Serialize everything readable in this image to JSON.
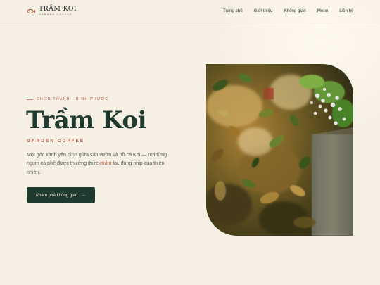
{
  "brand": {
    "name": "TRẦM KOI",
    "tagline": "GARDEN COFFEE",
    "logo_icon": "koi-fish-icon"
  },
  "nav": {
    "items": [
      "Trang chủ",
      "Giới thiệu",
      "Không gian",
      "Menu",
      "Liên hệ"
    ]
  },
  "hero": {
    "eyebrow": "CHƠN THÀNH · BÌNH PHƯỚC",
    "title": "Trầm Koi",
    "subtitle": "GARDEN COFFEE",
    "description_before": "Một góc xanh yên bình giữa sân vườn và hồ cá Koi — nơi từng ngụm cà phê được thưởng thức ",
    "description_highlight": "chậm",
    "description_after": " lại, đúng nhịp của thiên nhiên.",
    "cta_label": "Khám phá không gian",
    "cta_icon": "arrow-right-icon",
    "image_icon": "garden-photo"
  },
  "colors": {
    "background": "#f6efe4",
    "primary": "#1f3a2f",
    "accent": "#c0593e"
  }
}
